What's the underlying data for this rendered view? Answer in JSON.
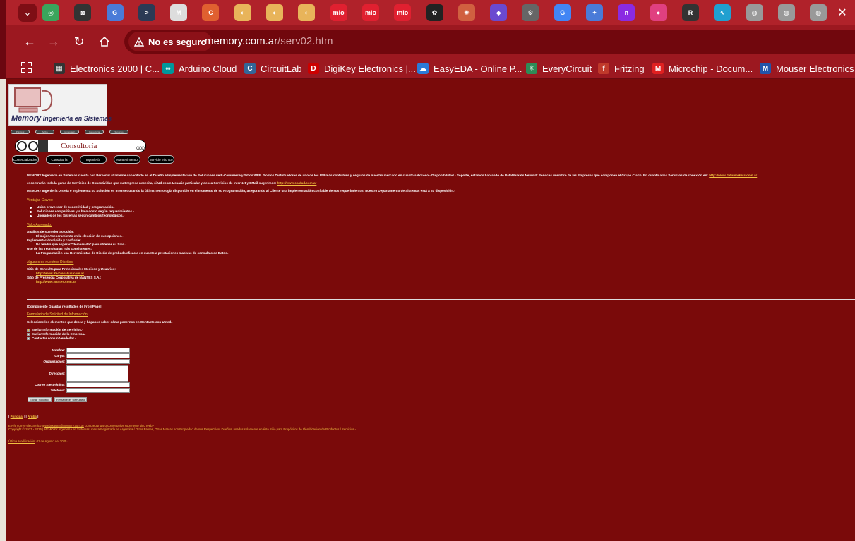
{
  "browser": {
    "tab_menu_icon": "chevron-down-icon",
    "tabs": [
      {
        "icon": "ring-icon",
        "color": "#3ba55c",
        "glyph": "◎"
      },
      {
        "icon": "camera-icon",
        "color": "#333333",
        "glyph": "◙"
      },
      {
        "icon": "translate-icon",
        "color": "#4a7bd8",
        "glyph": "G"
      },
      {
        "icon": "terminal-icon",
        "color": "#2b3a55",
        "glyph": ">"
      },
      {
        "icon": "m-circle-icon",
        "color": "#dddddd",
        "glyph": "M"
      },
      {
        "icon": "c-orange-icon",
        "color": "#e06030",
        "glyph": "C"
      },
      {
        "icon": "pie-icon",
        "color": "#e8b45a",
        "glyph": "◐"
      },
      {
        "icon": "pie-icon",
        "color": "#e8b45a",
        "glyph": "◐"
      },
      {
        "icon": "pie-icon",
        "color": "#e8b45a",
        "glyph": "◐"
      },
      {
        "icon": "mio-icon",
        "color": "#e02030",
        "glyph": "mio"
      },
      {
        "icon": "mio-icon",
        "color": "#e02030",
        "glyph": "mio"
      },
      {
        "icon": "mio-icon",
        "color": "#e02030",
        "glyph": "mio"
      },
      {
        "icon": "openai-icon",
        "color": "#222222",
        "glyph": "✿"
      },
      {
        "icon": "sun-icon",
        "color": "#d06040",
        "glyph": "✺"
      },
      {
        "icon": "shield-icon",
        "color": "#6a4ad0",
        "glyph": "◆"
      },
      {
        "icon": "settings-icon",
        "color": "#666666",
        "glyph": "⚙"
      },
      {
        "icon": "google-icon",
        "color": "#4285f4",
        "glyph": "G"
      },
      {
        "icon": "gemini-icon",
        "color": "#4a7bd8",
        "glyph": "✦"
      },
      {
        "icon": "notion-icon",
        "color": "#8a2be2",
        "glyph": "n"
      },
      {
        "icon": "palette-icon",
        "color": "#e04080",
        "glyph": "●"
      },
      {
        "icon": "r-circle-icon",
        "color": "#333333",
        "glyph": "R"
      },
      {
        "icon": "pulse-icon",
        "color": "#20a0d0",
        "glyph": "∿"
      },
      {
        "icon": "globe-icon",
        "color": "#999999",
        "glyph": "◍"
      },
      {
        "icon": "globe-icon",
        "color": "#999999",
        "glyph": "◍"
      },
      {
        "icon": "globe-icon",
        "color": "#999999",
        "glyph": "◍"
      }
    ],
    "close_icon": "close-icon",
    "security_label": "No es seguro",
    "url_host": "memory.com.ar",
    "url_path": "/serv02.htm",
    "bookmarks": [
      {
        "label": "Electronics 2000 | C...",
        "icon": "grid-icon",
        "color": "#333333",
        "glyph": "▦"
      },
      {
        "label": "Arduino Cloud",
        "icon": "arduino-icon",
        "color": "#00979c",
        "glyph": "∞"
      },
      {
        "label": "CircuitLab",
        "icon": "circuitlab-icon",
        "color": "#336699",
        "glyph": "C"
      },
      {
        "label": "DigiKey Electronics |...",
        "icon": "digikey-icon",
        "color": "#cc0000",
        "glyph": "D"
      },
      {
        "label": "EasyEDA - Online P...",
        "icon": "easyeda-icon",
        "color": "#2b7bd8",
        "glyph": "☁"
      },
      {
        "label": "EveryCircuit",
        "icon": "everycircuit-icon",
        "color": "#2e8b57",
        "glyph": "✳"
      },
      {
        "label": "Fritzing",
        "icon": "fritzing-icon",
        "color": "#c0392b",
        "glyph": "f"
      },
      {
        "label": "Microchip - Docum...",
        "icon": "microchip-icon",
        "color": "#e02020",
        "glyph": "M"
      },
      {
        "label": "Mouser Electronics",
        "icon": "mouser-icon",
        "color": "#2255aa",
        "glyph": "M"
      }
    ]
  },
  "page": {
    "logo_brand": "Memory",
    "logo_sub": "Ingeniería en Sistemas",
    "mini_nav": [
      "Principal",
      "Arriba",
      "Comercializ.",
      "Consultoría",
      "Servicios"
    ],
    "banner_title": "Consultoría",
    "pill_nav": [
      "Comercialización",
      "Consultoría",
      "Ingeniería",
      "Mantenimiento",
      "Servicio Técnico"
    ],
    "intro1": "MEMORY   Ingeniería en Sistemas cuenta con Personal altamente capacitado en el Diseño e Implementación de Soluciones de E-Commerce y Sitios WEB.  Somos Distribuidores de uno de los ISP más confiables y seguros de nuestro mercado en cuanto a Acceso - Disponibilidad - Soporte, estamos hablando de DataMarkets Network Services miembro de las Empresas que componen el Grupo Clarín.  En cuanto a los Servicios de conexión en:",
    "intro1_link": "http://www.datamarkets.com.ar",
    "intro2": "encontrarán toda la gama de Servicios de Conectividad que su Empresa necesita, si Ud es un Usuario particular y desea Servicios de InterNet y EMail sugerimos:",
    "intro2_link": "http://www.ciudad.com.ar",
    "intro3": "MEMORY   Ingeniería Diseña e Implementa su Solución en InterNet usando la última Tecnología disponible en el momento de su Programación, asegurando al Cliente una implementación confiable de sus requerimientos, nuestro Departamento de Sistemas está a su disposición.-",
    "ventajas_title": "Ventajas Claves:",
    "ventajas": [
      "Unico proveedor de conectividad y programación.-",
      "Soluciones competitivas y a bajo costo según requerimientos.-",
      "Upgrades de los Sistemas según cambios tecnológicos.-"
    ],
    "valor_title": "Valor Agregado:",
    "valor": [
      {
        "head": "Análisis de su mejor Solución:",
        "body": "El mejor Asesoramiento en la elección de sus opciones.-"
      },
      {
        "head": "Implementación rápida y confiable:",
        "body": "No tendrá que esperar \"demasiado\" para obtener su Sitio.-"
      },
      {
        "head": "Uso de las Tecnologías más consistentes:",
        "body": "La Programación usa Herramientas de Diseño de probada eficacia en cuanto a prestaciones masivas de consultas de Datos.-"
      }
    ],
    "disenos_title": "Algunos de nuestros Diseños:",
    "disenos": [
      {
        "head": "Sitio de Consulta para Profesionales Médicos y Usuarios:",
        "link": "http://www.RedVesalius.com.ar"
      },
      {
        "head": "Sitio de Presencia Corporativa de NANTES S.A.:",
        "link": "http://www.Nantes.com.ar"
      }
    ],
    "frontpage_note": "[Componente Guardar resultados de FrontPage]",
    "form_title": "Formulario de Solicitud de Información:",
    "form_intro": "Seleccione los elementos que desea y háganos saber cómo ponernos en Contacto con Usted.-",
    "checkboxes": [
      {
        "label": "Enviar Información de Servicios.-",
        "checked": true
      },
      {
        "label": "Enviar Información de la Empresa.-",
        "checked": false
      },
      {
        "label": "Contactar con un Vendedor.-",
        "checked": false
      }
    ],
    "fields": {
      "nombre": "Nombre:",
      "cargo": "Cargo:",
      "organizacion": "Organización:",
      "direccion": "Dirección:",
      "correo": "Correo Electrónico:",
      "telefono": "Teléfono:"
    },
    "submit_label": "Enviar Solicitud",
    "reset_label": "Restablecer formulario",
    "footer_nav_open": "[ ",
    "footer_nav_principal": "Principal",
    "footer_nav_sep": " ] [ ",
    "footer_nav_arriba": "Arriba",
    "footer_nav_close": " ]",
    "footer_mail_pre": "Envíe correo electrónico a ",
    "footer_mail_link": "WebMaster@memory.com.ar",
    "footer_mail_post": " con preguntas o comentarios sobre este sitio Web.-",
    "footer_copyright": "Copyright © 1977 - 2026 | MEMORY Ingeniería en Sistemas, marca Registrada en Argentina / Otros Países, Otras Marcas son Propiedad de sus Respectivos Dueños, usadas solamente en éste Sitio para Propósitos de Identificación de Productos / Servicios.-",
    "footer_mod_label": "Última Modificación",
    "footer_mod_date": ": 01 de Agosto  del 2025.-"
  }
}
